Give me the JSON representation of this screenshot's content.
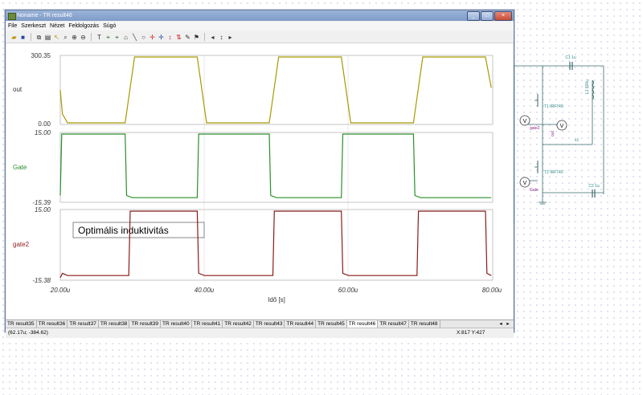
{
  "window": {
    "title": "Noname - TR result46",
    "buttons": [
      "_",
      "□",
      "×"
    ]
  },
  "menu": [
    "File",
    "Szerkeszt",
    "Nézet",
    "Feldolgozás",
    "Súgó"
  ],
  "toolbar": {
    "icons": [
      "open-folder-icon",
      "save-icon",
      "copy-icon",
      "paste-icon",
      "cursor-icon",
      "zoom-icon",
      "zoom-in-icon",
      "zoom-out-icon",
      "text-icon",
      "cursor-a-icon",
      "cursor-b-icon",
      "home-icon",
      "line-icon",
      "circle-icon",
      "marker-icon",
      "marker2-icon",
      "marker3-icon",
      "marker4-icon",
      "pen-icon",
      "flag-icon",
      "nav-left-icon",
      "nav-updown-icon",
      "nav-right-icon"
    ]
  },
  "charts": {
    "out": {
      "label": "out",
      "ymax": "300.35",
      "ymin": "0.00"
    },
    "gate": {
      "label": "Gate",
      "ymax": "15.00",
      "ymin": "-15.39"
    },
    "gate2": {
      "label": "gate2",
      "ymax": "15.00",
      "ymin": "-15.38"
    },
    "x_ticks": [
      "20.00u",
      "40.00u",
      "60.00u",
      "80.00u"
    ],
    "x_label": "Idő [s]",
    "annotation": "Optimális induktivitás"
  },
  "chart_data": [
    {
      "type": "line",
      "title": "",
      "ylabel": "out",
      "xlim": [
        2e-05,
        8e-05
      ],
      "ylim": [
        0,
        300.35
      ],
      "series": [
        {
          "name": "out",
          "color": "#a89a00",
          "x": [
            20.0,
            20.3,
            21.0,
            29.0,
            30.3,
            39.0,
            40.3,
            49.0,
            50.3,
            59.0,
            60.3,
            69.0,
            70.3,
            79.0,
            79.8
          ],
          "values": [
            150,
            40,
            0,
            0,
            300.35,
            300.35,
            0,
            0,
            300.35,
            300.35,
            0,
            0,
            300.35,
            300.35,
            160
          ]
        }
      ]
    },
    {
      "type": "line",
      "title": "",
      "ylabel": "Gate",
      "xlim": [
        2e-05,
        8e-05
      ],
      "ylim": [
        -15.39,
        15.0
      ],
      "series": [
        {
          "name": "Gate",
          "color": "#2a8f2a",
          "x": [
            20.0,
            20.2,
            29.0,
            29.2,
            30.0,
            39.0,
            39.2,
            40.0,
            49.0,
            49.2,
            50.0,
            59.0,
            59.2,
            60.0,
            69.0,
            69.2,
            70.0,
            79.0,
            79.8
          ],
          "values": [
            -13,
            15,
            15,
            -13,
            -14,
            -14,
            15,
            15,
            15,
            -13,
            -14,
            -14,
            15,
            15,
            15,
            -13,
            -14,
            -14,
            -14
          ]
        }
      ]
    },
    {
      "type": "line",
      "title": "",
      "ylabel": "gate2",
      "xlim": [
        2e-05,
        8e-05
      ],
      "ylim": [
        -15.38,
        15.0
      ],
      "series": [
        {
          "name": "gate2",
          "color": "#8b1a1a",
          "x": [
            20.0,
            20.3,
            21,
            29.5,
            29.7,
            39.0,
            39.2,
            40,
            49.5,
            49.7,
            59.0,
            59.2,
            60,
            69.5,
            69.7,
            79.0,
            79.2,
            79.8
          ],
          "values": [
            -15,
            -13,
            -14,
            -14,
            15,
            15,
            -13,
            -14,
            -14,
            15,
            15,
            -13,
            -14,
            -14,
            15,
            15,
            -13,
            -14
          ]
        }
      ]
    }
  ],
  "tabs": [
    "TR result35",
    "TR result36",
    "TR result37",
    "TR result38",
    "TR result39",
    "TR result40",
    "TR result41",
    "TR result42",
    "TR result43",
    "TR result44",
    "TR result45",
    "TR result46",
    "TR result47",
    "TR result48"
  ],
  "active_tab": "TR result46",
  "status": {
    "left": "(62.17u; -384.62)",
    "right": "X:817  Y:427"
  },
  "schematic": {
    "labels": {
      "c1": "C1 1u",
      "c2": "C2 1u",
      "l1": "L1 600u",
      "t1": "T1 IRF740",
      "t2": "T2 IRF740",
      "gate2": "gate2",
      "out": "out",
      "gate": "Gate",
      "x1": "x1",
      "v": "V"
    }
  }
}
